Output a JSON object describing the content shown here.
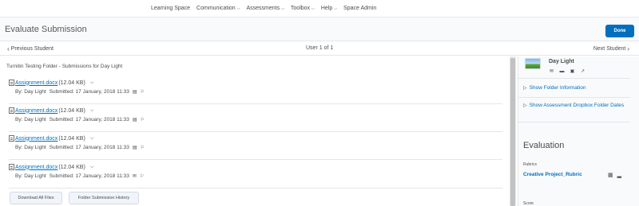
{
  "topnav": {
    "items": [
      {
        "label": "Learning Space",
        "has_menu": false
      },
      {
        "label": "Communication",
        "has_menu": true
      },
      {
        "label": "Assessments",
        "has_menu": true
      },
      {
        "label": "Toolbox",
        "has_menu": true
      },
      {
        "label": "Help",
        "has_menu": true
      },
      {
        "label": "Space Admin",
        "has_menu": false
      }
    ]
  },
  "header": {
    "title": "Evaluate Submission",
    "done_label": "Done"
  },
  "student_nav": {
    "prev_label": "Previous Student",
    "count": "User 1 of 1",
    "next_label": "Next Student"
  },
  "main": {
    "folder_title": "Turnitin Testing Folder - Submissions for Day Light",
    "submissions": [
      {
        "file_name": "Assignment.docx",
        "size": "(12.04 KB)",
        "by": "By: Day Light",
        "submitted": "Submitted: 17 January, 2018 11:33"
      },
      {
        "file_name": "Assignment.docx",
        "size": "(12.04 KB)",
        "by": "By: Day Light",
        "submitted": "Submitted: 17 January, 2018 11:33"
      },
      {
        "file_name": "Assignment.docx",
        "size": "(12.04 KB)",
        "by": "By: Day Light",
        "submitted": "Submitted: 17 January, 2018 11:33"
      },
      {
        "file_name": "Assignment.docx",
        "size": "(12.04 KB)",
        "by": "By: Day Light",
        "submitted": "Submitted: 17 January, 2018 11:33"
      }
    ],
    "download_all_label": "Download All Files",
    "history_label": "Folder Submission History"
  },
  "side": {
    "student_name": "Day Light",
    "show_folder_info": "Show Folder Information",
    "show_dates": "Show Assessment Dropbox Folder Dates",
    "evaluation_title": "Evaluation",
    "rubrics_label": "Rubrics",
    "rubric_name": "Creative Project_Rubric",
    "score_label": "Score"
  },
  "colors": {
    "accent": "#006fbf",
    "text": "#494c4e"
  }
}
